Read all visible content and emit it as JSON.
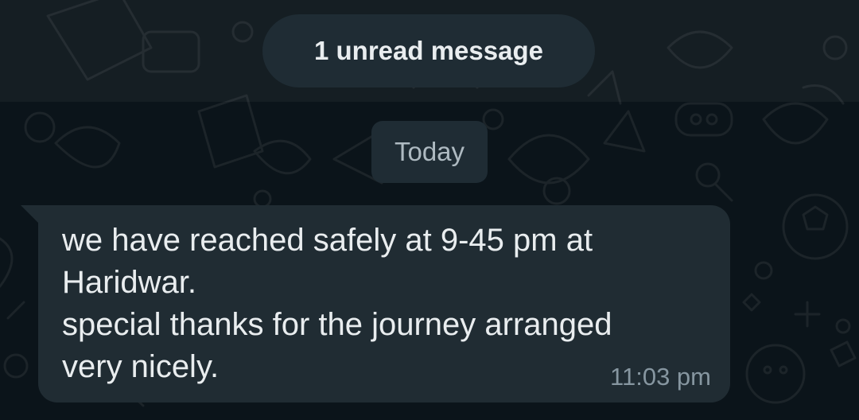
{
  "chat": {
    "unread_banner": "1 unread message",
    "date_divider": "Today",
    "message": {
      "lines": [
        "we have reached safely at 9-45 pm at",
        "Haridwar.",
        "special thanks for the journey arranged",
        "very nicely."
      ],
      "time": "11:03 pm"
    }
  },
  "colors": {
    "background": "#0b141a",
    "bubble_incoming": "#202c33",
    "text_primary": "#e9edef",
    "text_secondary": "#8696a0"
  }
}
